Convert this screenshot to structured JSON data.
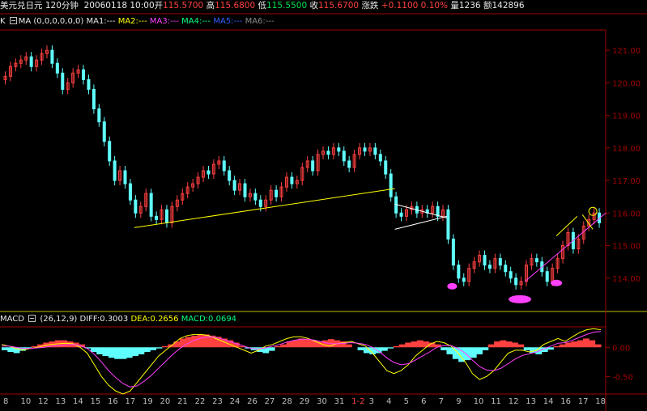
{
  "header": {
    "title": "美元兑日元",
    "period": "120分钟",
    "datetime": "20060118 10:00",
    "open_label": "开",
    "open": "115.5700",
    "high_label": "高",
    "high": "115.6800",
    "low_label": "低",
    "low": "115.5500",
    "close_label": "收",
    "close": "115.6700",
    "change_label": "涨跌",
    "change": "+0.1100",
    "change_pct": "0.10%",
    "volume_label": "量",
    "volume": "1236",
    "amount_label": "额",
    "amount": "142896"
  },
  "ma_bar": {
    "k_label": "K",
    "ma_label": "MA",
    "params": "(0,0,0,0,0,0)",
    "items": [
      "MA1:---",
      "MA2:---",
      "MA3:---",
      "MA4:---",
      "MA5:---",
      "MA6:---"
    ]
  },
  "macd_bar": {
    "label": "MACD",
    "params": "(26,12,9)",
    "diff": "DIFF:0.3003",
    "dea": "DEA:0.2656",
    "macd": "MACD:0.0694"
  },
  "colors": {
    "up": "#ff4040",
    "down": "#60ffff",
    "trendline": "#ffff00",
    "diff_line": "#ffff00",
    "dea_line": "#ff40ff",
    "marker": "#ff40ff",
    "axis": "#a00000",
    "text": "#c0c0c0"
  },
  "chart_data": [
    {
      "type": "candlestick",
      "title": "",
      "ylabel": "",
      "ylim": [
        113.0,
        121.6
      ],
      "yticks": [
        "121.00",
        "120.00",
        "119.00",
        "118.00",
        "117.00",
        "116.00",
        "115.00",
        "114.00"
      ],
      "ytick_values": [
        121,
        120,
        119,
        118,
        117,
        116,
        115,
        114
      ],
      "x_labels": [
        "8",
        "10",
        "12",
        "13",
        "14",
        "15",
        "16",
        "17",
        "19",
        "20",
        "21",
        "22",
        "23",
        "24",
        "26",
        "27",
        "28",
        "29",
        "30",
        "31",
        "1-2",
        "3",
        "4",
        "5",
        "6",
        "7",
        "9",
        "10",
        "11",
        "12",
        "13",
        "14",
        "16",
        "17",
        "18"
      ],
      "close_path": [
        120.2,
        120.5,
        120.6,
        120.7,
        120.8,
        120.5,
        120.7,
        120.9,
        121.0,
        120.6,
        120.3,
        119.8,
        120.0,
        120.3,
        120.4,
        120.1,
        119.8,
        119.2,
        118.8,
        118.2,
        117.6,
        117.0,
        117.3,
        116.9,
        116.4,
        116.0,
        116.2,
        116.6,
        115.9,
        115.8,
        116.1,
        115.7,
        116.2,
        116.4,
        116.6,
        116.8,
        116.9,
        117.1,
        117.3,
        117.2,
        117.5,
        117.6,
        117.3,
        117.0,
        116.7,
        116.9,
        116.5,
        116.6,
        116.4,
        116.2,
        116.4,
        116.7,
        116.5,
        116.8,
        117.1,
        116.9,
        117.0,
        117.4,
        117.6,
        117.3,
        117.8,
        117.9,
        117.8,
        118.0,
        117.9,
        117.6,
        117.4,
        117.8,
        118.0,
        117.9,
        118.0,
        117.8,
        117.6,
        117.2,
        116.5,
        116.0,
        115.9,
        116.1,
        116.2,
        116.0,
        116.1,
        116.0,
        116.2,
        115.9,
        116.1,
        115.2,
        114.4,
        114.0,
        113.9,
        114.3,
        114.5,
        114.7,
        114.4,
        114.3,
        114.6,
        114.4,
        114.2,
        114.0,
        113.8,
        113.9,
        114.4,
        114.6,
        114.5,
        114.2,
        113.9,
        114.3,
        114.6,
        115.0,
        115.4,
        114.9,
        115.2,
        115.6,
        115.8,
        116.0,
        115.7
      ],
      "trendlines": [
        {
          "label": "",
          "from": [
            0,
            115.55
          ],
          "to": [
            0,
            116.75
          ]
        },
        {
          "label": "",
          "from": [
            0,
            116.2
          ],
          "to": [
            0,
            115.85
          ]
        },
        {
          "label": "",
          "from": [
            0,
            115.5
          ],
          "to": [
            0,
            115.9
          ]
        }
      ],
      "markers": [
        {
          "type": "pink-ellipse",
          "value": 113.75
        },
        {
          "type": "pink-ellipse-large",
          "value": 113.35
        },
        {
          "type": "pink-ellipse",
          "value": 113.85
        },
        {
          "type": "yellow-circle",
          "value": 116.05
        }
      ]
    },
    {
      "type": "macd",
      "params": [
        26,
        12,
        9
      ],
      "ylim": [
        -0.8,
        0.35
      ],
      "yticks": [
        "0.00",
        "-0.50"
      ],
      "ytick_values": [
        0.0,
        -0.5
      ],
      "histogram": [
        -0.05,
        -0.08,
        -0.1,
        -0.06,
        -0.02,
        0.02,
        0.05,
        0.08,
        0.1,
        0.12,
        0.12,
        0.1,
        0.08,
        0.05,
        -0.02,
        -0.08,
        -0.12,
        -0.15,
        -0.18,
        -0.2,
        -0.2,
        -0.18,
        -0.15,
        -0.12,
        -0.08,
        -0.05,
        -0.02,
        0.02,
        0.05,
        0.1,
        0.15,
        0.18,
        0.2,
        0.22,
        0.22,
        0.2,
        0.18,
        0.15,
        0.12,
        0.08,
        0.02,
        -0.02,
        -0.05,
        -0.08,
        -0.1,
        -0.06,
        0.02,
        0.05,
        0.1,
        0.12,
        0.15,
        0.14,
        0.12,
        0.1,
        0.12,
        0.14,
        0.12,
        0.1,
        0.05,
        0.0,
        -0.05,
        -0.1,
        -0.12,
        -0.1,
        -0.06,
        -0.02,
        0.02,
        0.05,
        0.08,
        0.1,
        0.12,
        0.1,
        0.08,
        0.05,
        -0.05,
        -0.12,
        -0.2,
        -0.25,
        -0.22,
        -0.18,
        -0.12,
        -0.05,
        0.05,
        0.1,
        0.12,
        0.1,
        0.08,
        0.05,
        -0.05,
        -0.1,
        -0.12,
        -0.08,
        -0.04,
        0.02,
        0.05,
        0.08,
        0.1,
        0.12,
        0.15,
        0.12,
        0.05
      ],
      "diff_path": [
        0.05,
        0.02,
        -0.02,
        -0.05,
        -0.02,
        0.0,
        0.03,
        0.05,
        0.06,
        0.07,
        0.06,
        0.0,
        -0.1,
        -0.3,
        -0.5,
        -0.65,
        -0.75,
        -0.8,
        -0.75,
        -0.6,
        -0.45,
        -0.3,
        -0.15,
        -0.05,
        0.05,
        0.15,
        0.2,
        0.22,
        0.22,
        0.2,
        0.15,
        0.1,
        0.05,
        0.0,
        -0.05,
        -0.1,
        -0.05,
        0.02,
        0.05,
        0.1,
        0.15,
        0.18,
        0.18,
        0.15,
        0.1,
        0.05,
        0.02,
        0.06,
        0.08,
        0.1,
        0.06,
        0.02,
        -0.1,
        -0.25,
        -0.4,
        -0.45,
        -0.4,
        -0.3,
        -0.15,
        -0.05,
        0.05,
        0.1,
        0.08,
        0.02,
        -0.1,
        -0.25,
        -0.45,
        -0.55,
        -0.5,
        -0.4,
        -0.25,
        -0.1,
        -0.05,
        -0.05,
        -0.08,
        -0.05,
        0.05,
        0.1,
        0.15,
        0.1,
        0.18,
        0.25,
        0.3,
        0.32,
        0.3
      ],
      "dea_path": [
        0.02,
        0.02,
        0.0,
        -0.02,
        -0.02,
        -0.01,
        0.0,
        0.02,
        0.03,
        0.04,
        0.05,
        0.03,
        -0.02,
        -0.12,
        -0.25,
        -0.4,
        -0.52,
        -0.62,
        -0.68,
        -0.66,
        -0.58,
        -0.48,
        -0.36,
        -0.24,
        -0.12,
        -0.02,
        0.06,
        0.12,
        0.16,
        0.18,
        0.17,
        0.14,
        0.1,
        0.06,
        0.02,
        -0.02,
        -0.03,
        -0.01,
        0.02,
        0.05,
        0.09,
        0.12,
        0.14,
        0.14,
        0.12,
        0.09,
        0.06,
        0.06,
        0.07,
        0.08,
        0.07,
        0.05,
        0.0,
        -0.08,
        -0.18,
        -0.26,
        -0.3,
        -0.28,
        -0.22,
        -0.15,
        -0.08,
        0.0,
        0.03,
        0.03,
        -0.02,
        -0.1,
        -0.22,
        -0.33,
        -0.39,
        -0.4,
        -0.36,
        -0.28,
        -0.2,
        -0.14,
        -0.11,
        -0.08,
        -0.03,
        0.02,
        0.07,
        0.08,
        0.12,
        0.17,
        0.22,
        0.26,
        0.27
      ]
    }
  ]
}
